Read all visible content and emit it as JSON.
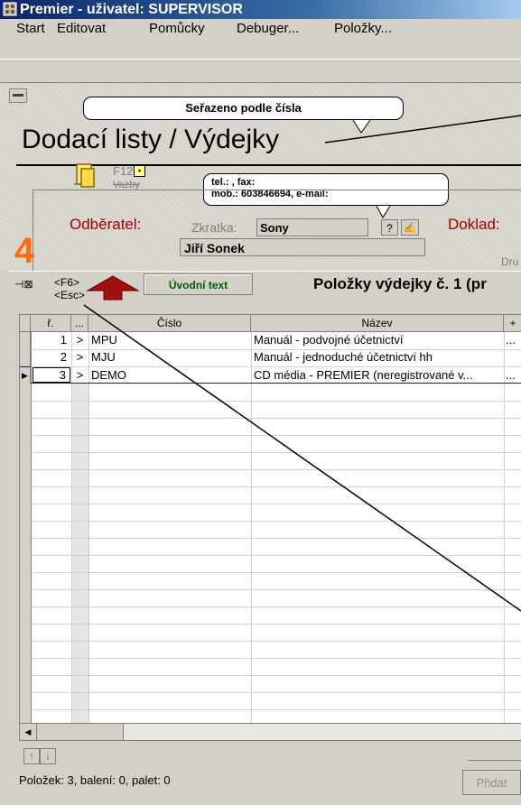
{
  "window": {
    "title": "Premier - uživatel: SUPERVISOR"
  },
  "menu": [
    "Start",
    "Editovat",
    "Pomůcky",
    "Debuger...",
    "Položky..."
  ],
  "bubbles": {
    "sort": "Seřazeno podle čísla",
    "contact_line1": "tel.: , fax:",
    "contact_line2": "mob.: 603846694, e-mail:"
  },
  "form": {
    "heading": "Dodací listy / Výdejky",
    "f12_label": "F12",
    "vazby_label": "Vazby",
    "customer_label": "Odběratel:",
    "zkratka_label": "Zkratka:",
    "zkratka_value": "Sony",
    "help_button": "?",
    "customer_name": "Jiří Sonek",
    "doklad_label": "Doklad:",
    "dru_label": "Dru",
    "step_number": "4"
  },
  "items": {
    "key_f6": "<F6>",
    "key_esc": "<Esc>",
    "intro_button": "Úvodní text",
    "title": "Položky výdejky č. 1 (pr",
    "columns": [
      "ř.",
      "...",
      "Číslo",
      "Název",
      "+"
    ],
    "rows": [
      {
        "n": "1",
        "mark": ">",
        "cislo": "MPU",
        "nazev": "Manuál - podvojné účetnictví",
        "plus": "..."
      },
      {
        "n": "2",
        "mark": ">",
        "cislo": "MJU",
        "nazev": "Manuál - jednoduché účetnictví hh",
        "plus": ""
      },
      {
        "n": "3",
        "mark": ">",
        "cislo": "DEMO",
        "nazev": "CD média - PREMIER (neregistrované v...",
        "plus": "..."
      }
    ]
  },
  "footer": {
    "status": "Položek: 3, balení: 0, palet: 0",
    "add_button": "Přidat"
  },
  "colors": {
    "label_red": "#a00000",
    "step_orange": "#ff6a13",
    "intro_green": "#006000",
    "title_blue": "#0a246a"
  }
}
